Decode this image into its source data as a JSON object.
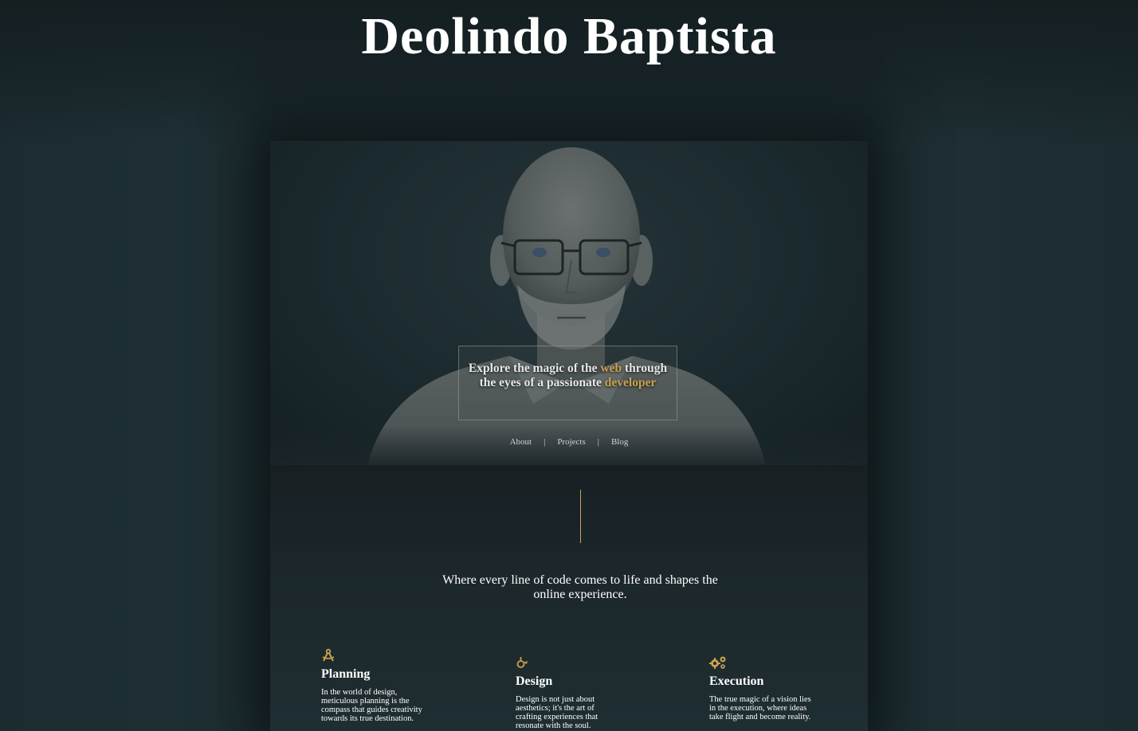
{
  "site": {
    "title": "Deolindo Baptista"
  },
  "hero": {
    "tagline_pre": "Explore the magic of the ",
    "tagline_hl1": "web",
    "tagline_mid": " through the eyes of a passionate ",
    "tagline_hl2": "developer",
    "nav": [
      {
        "label": "About"
      },
      {
        "label": "Projects"
      },
      {
        "label": "Blog"
      }
    ],
    "nav_separator": "|"
  },
  "intro": {
    "subtitle": "Where every line of code comes to life and shapes the online experience."
  },
  "features": [
    {
      "icon": "compass-drafting-icon",
      "title": "Planning",
      "text": "In the world of design, meticulous planning is the compass that guides creativity towards its true destination."
    },
    {
      "icon": "pen-nib-icon",
      "title": "Design",
      "text": "Design is not just about aesthetics; it's the art of crafting experiences that resonate with the soul."
    },
    {
      "icon": "gears-icon",
      "title": "Execution",
      "text": "The true magic of a vision lies in the execution, where ideas take flight and become reality."
    }
  ],
  "colors": {
    "accent": "#c9a24d",
    "background": "#1a282c",
    "text": "#ffffff"
  }
}
